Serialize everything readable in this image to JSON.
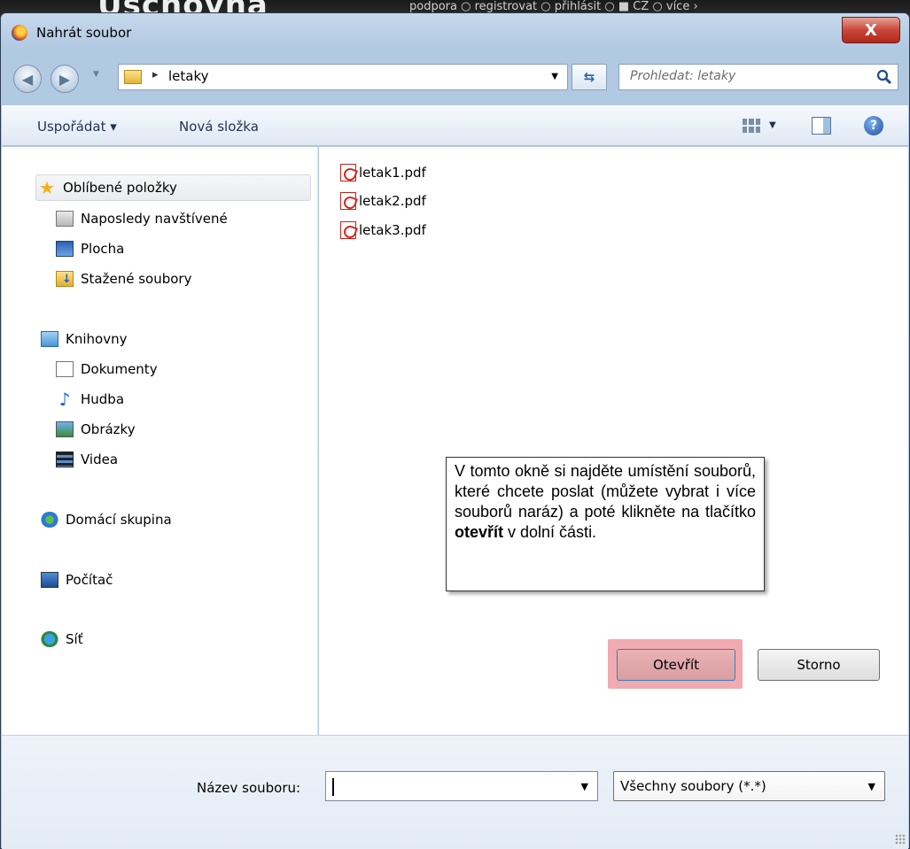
{
  "background": {
    "logo_text": "Uschovna",
    "nav_text": "podpora  ○  registrovat  ○  přihlásit  ○  ■ CZ  ○  více ›"
  },
  "dialog": {
    "title": "Nahrát soubor",
    "close_symbol": "X",
    "address": {
      "separator": "▸",
      "current_folder": "letaky",
      "search_placeholder": "Prohledat: letaky"
    },
    "toolbar": {
      "organize_label": "Uspořádat ▾",
      "new_folder_label": "Nová složka"
    },
    "nav_pane": {
      "favorites": {
        "label": "Oblíbené položky",
        "icon": "star-icon"
      },
      "favorites_items": [
        {
          "label": "Naposledy navštívené",
          "icon": "recent-places-icon"
        },
        {
          "label": "Plocha",
          "icon": "desktop-icon"
        },
        {
          "label": "Stažené soubory",
          "icon": "downloads-icon"
        }
      ],
      "libraries": {
        "label": "Knihovny",
        "icon": "libraries-icon"
      },
      "libraries_items": [
        {
          "label": "Dokumenty",
          "icon": "documents-icon"
        },
        {
          "label": "Hudba",
          "icon": "music-icon"
        },
        {
          "label": "Obrázky",
          "icon": "pictures-icon"
        },
        {
          "label": "Videa",
          "icon": "videos-icon"
        }
      ],
      "homegroup": {
        "label": "Domácí skupina",
        "icon": "homegroup-icon"
      },
      "computer": {
        "label": "Počítač",
        "icon": "computer-icon"
      },
      "network": {
        "label": "Síť",
        "icon": "network-icon"
      }
    },
    "files": [
      {
        "name": "letak1.pdf",
        "icon": "pdf-icon"
      },
      {
        "name": "letak2.pdf",
        "icon": "pdf-icon"
      },
      {
        "name": "letak3.pdf",
        "icon": "pdf-icon"
      }
    ],
    "callout": {
      "text_before": "V tomto okně si najděte umístění souborů, které chcete poslat (můžete vybrat i více souborů naráz) a poté klikněte na tlačítko ",
      "bold": "otevřít",
      "text_after": " v dolní části."
    },
    "footer": {
      "filename_label": "Název souboru:",
      "filename_value": "",
      "filter_value": "Všechny soubory (*.*)",
      "open_button": "Otevřít",
      "cancel_button": "Storno"
    },
    "colors": {
      "highlight": "#f0aab0",
      "chrome": "#b7cde6",
      "close_button": "#c8473a"
    }
  }
}
